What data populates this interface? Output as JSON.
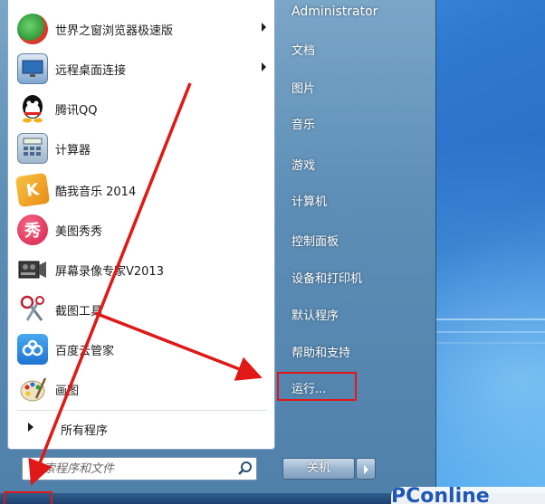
{
  "start_menu": {
    "programs": [
      {
        "label": "世界之窗浏览器极速版",
        "icon": "browser-icon",
        "has_submenu": true
      },
      {
        "label": "远程桌面连接",
        "icon": "remote-desktop-icon",
        "has_submenu": true
      },
      {
        "label": "腾讯QQ",
        "icon": "qq-icon",
        "has_submenu": false
      },
      {
        "label": "计算器",
        "icon": "calculator-icon",
        "has_submenu": false
      },
      {
        "label": "酷我音乐 2014",
        "icon": "kuwo-music-icon",
        "has_submenu": false
      },
      {
        "label": "美图秀秀",
        "icon": "meitu-icon",
        "has_submenu": false
      },
      {
        "label": "屏幕录像专家V2013",
        "icon": "screen-recorder-icon",
        "has_submenu": false
      },
      {
        "label": "截图工具",
        "icon": "snipping-tool-icon",
        "has_submenu": false
      },
      {
        "label": "百度云管家",
        "icon": "baidu-cloud-icon",
        "has_submenu": false
      },
      {
        "label": "画图",
        "icon": "paint-icon",
        "has_submenu": false
      }
    ],
    "all_programs_label": "所有程序",
    "search_placeholder": "搜索程序和文件",
    "right_column": {
      "user": "Administrator",
      "items": [
        "文档",
        "图片",
        "音乐",
        "游戏",
        "计算机",
        "控制面板",
        "设备和打印机",
        "默认程序",
        "帮助和支持",
        "运行..."
      ]
    },
    "shutdown_label": "关机",
    "highlight_color": "#e01818"
  },
  "watermark": {
    "text": "PConline"
  }
}
